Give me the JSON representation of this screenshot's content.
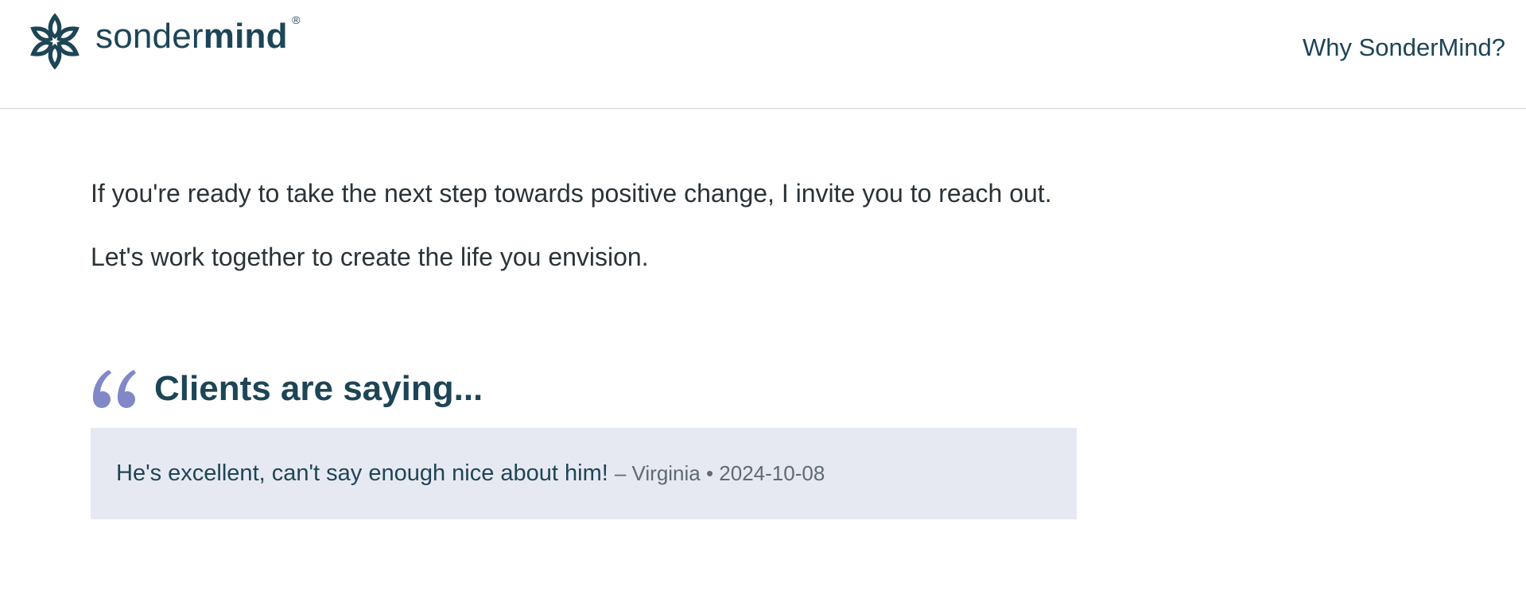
{
  "header": {
    "logo": {
      "icon": "sondermind-flower-logo-icon",
      "wordmark_light": "sonder",
      "wordmark_bold": "mind",
      "registered": "®"
    },
    "nav_link": "Why SonderMind?"
  },
  "main": {
    "intro_text": "If you're ready to take the next step towards positive change, I invite you to reach out. Let's work together to create the life you envision."
  },
  "testimonials": {
    "quote_icon": "quote-icon",
    "title": "Clients are saying...",
    "items": [
      {
        "text": "He's excellent, can't say enough nice about him!",
        "meta": "– Virginia • 2024-10-08"
      }
    ]
  },
  "colors": {
    "brand": "#1d4556",
    "quote_accent": "#8088c7",
    "card_background": "#e7e9f2",
    "body_text": "#2b3338",
    "meta_text": "#5f6a72"
  }
}
